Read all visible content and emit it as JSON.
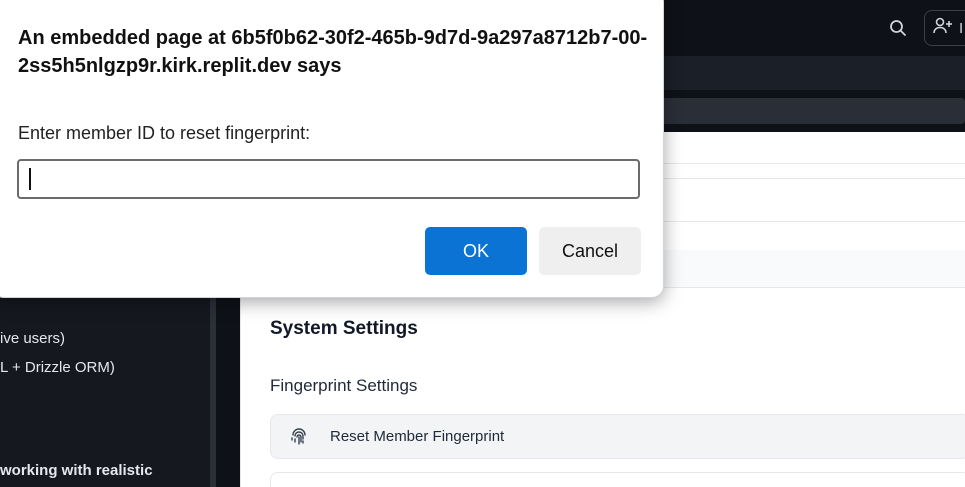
{
  "dialog": {
    "title": "An embedded page at 6b5f0b62-30f2-465b-9d7d-9a297a8712b7-00-2ss5h5nlgzp9r.kirk.replit.dev says",
    "message": "Enter member ID to reset fingerprint:",
    "input_value": "",
    "ok_label": "OK",
    "cancel_label": "Cancel"
  },
  "topbar": {
    "search_icon": "search-icon",
    "user_icon": "user-plus-icon",
    "user_label": "I"
  },
  "sidebar": {
    "lines": [
      "ive users)",
      "L + Drizzle ORM)",
      "working with realistic"
    ]
  },
  "main": {
    "section_title": "System Settings",
    "subsection_title": "Fingerprint Settings",
    "items": [
      {
        "label": "Reset Member Fingerprint",
        "icon": "fingerprint-icon"
      }
    ]
  },
  "colors": {
    "ok_button": "#0a73d4",
    "topbar": "#0e1117",
    "sidebar": "#15181f"
  }
}
